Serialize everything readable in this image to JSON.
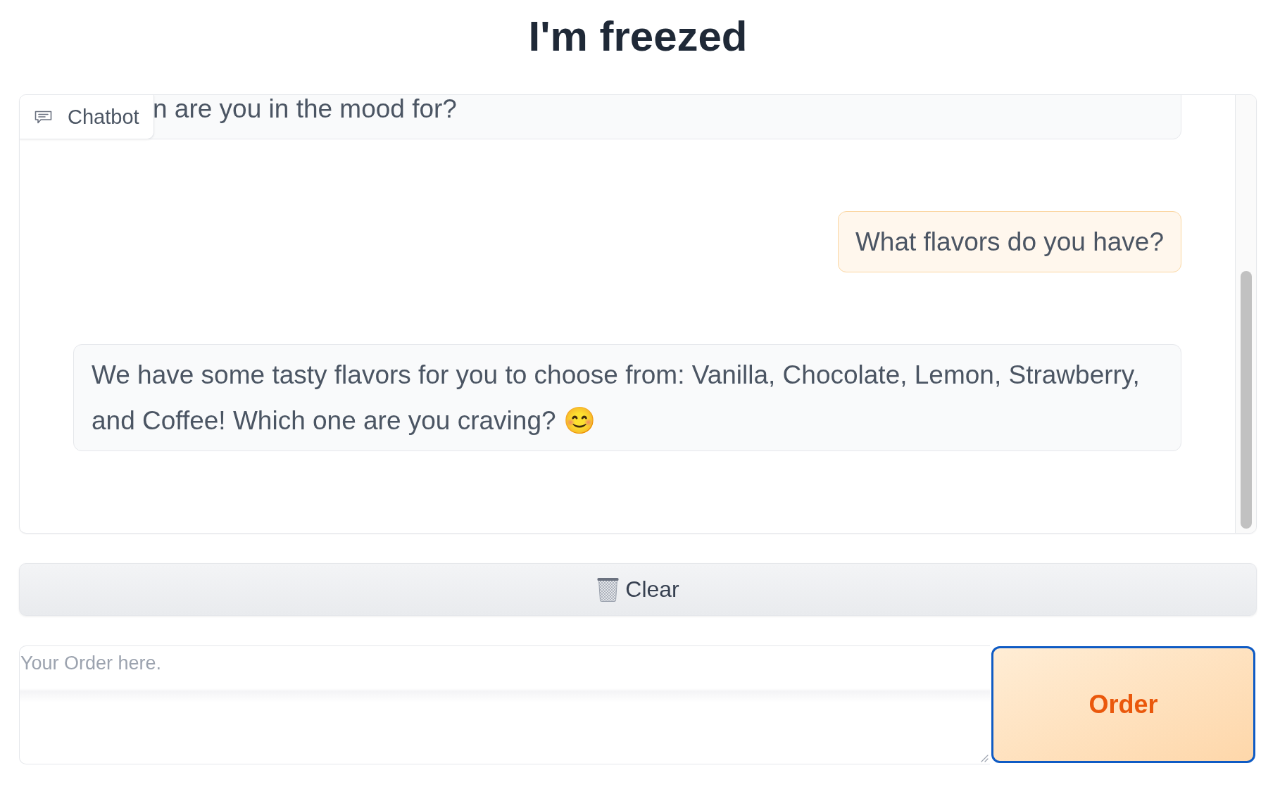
{
  "title": "I'm freezed",
  "chatbot": {
    "label": "Chatbot",
    "messages": [
      {
        "kind": "bot",
        "text": "n are you in the mood for?"
      },
      {
        "kind": "user",
        "text": "What flavors do you have?"
      },
      {
        "kind": "bot",
        "text": "We have some tasty flavors for you to choose from: Vanilla, Chocolate, Lemon, Strawberry, and Coffee! Which one are you craving? 😊"
      }
    ]
  },
  "clear_button": {
    "label": "Clear"
  },
  "order_input": {
    "placeholder": "Your Order here."
  },
  "order_button": {
    "label": "Order",
    "focused": true
  }
}
